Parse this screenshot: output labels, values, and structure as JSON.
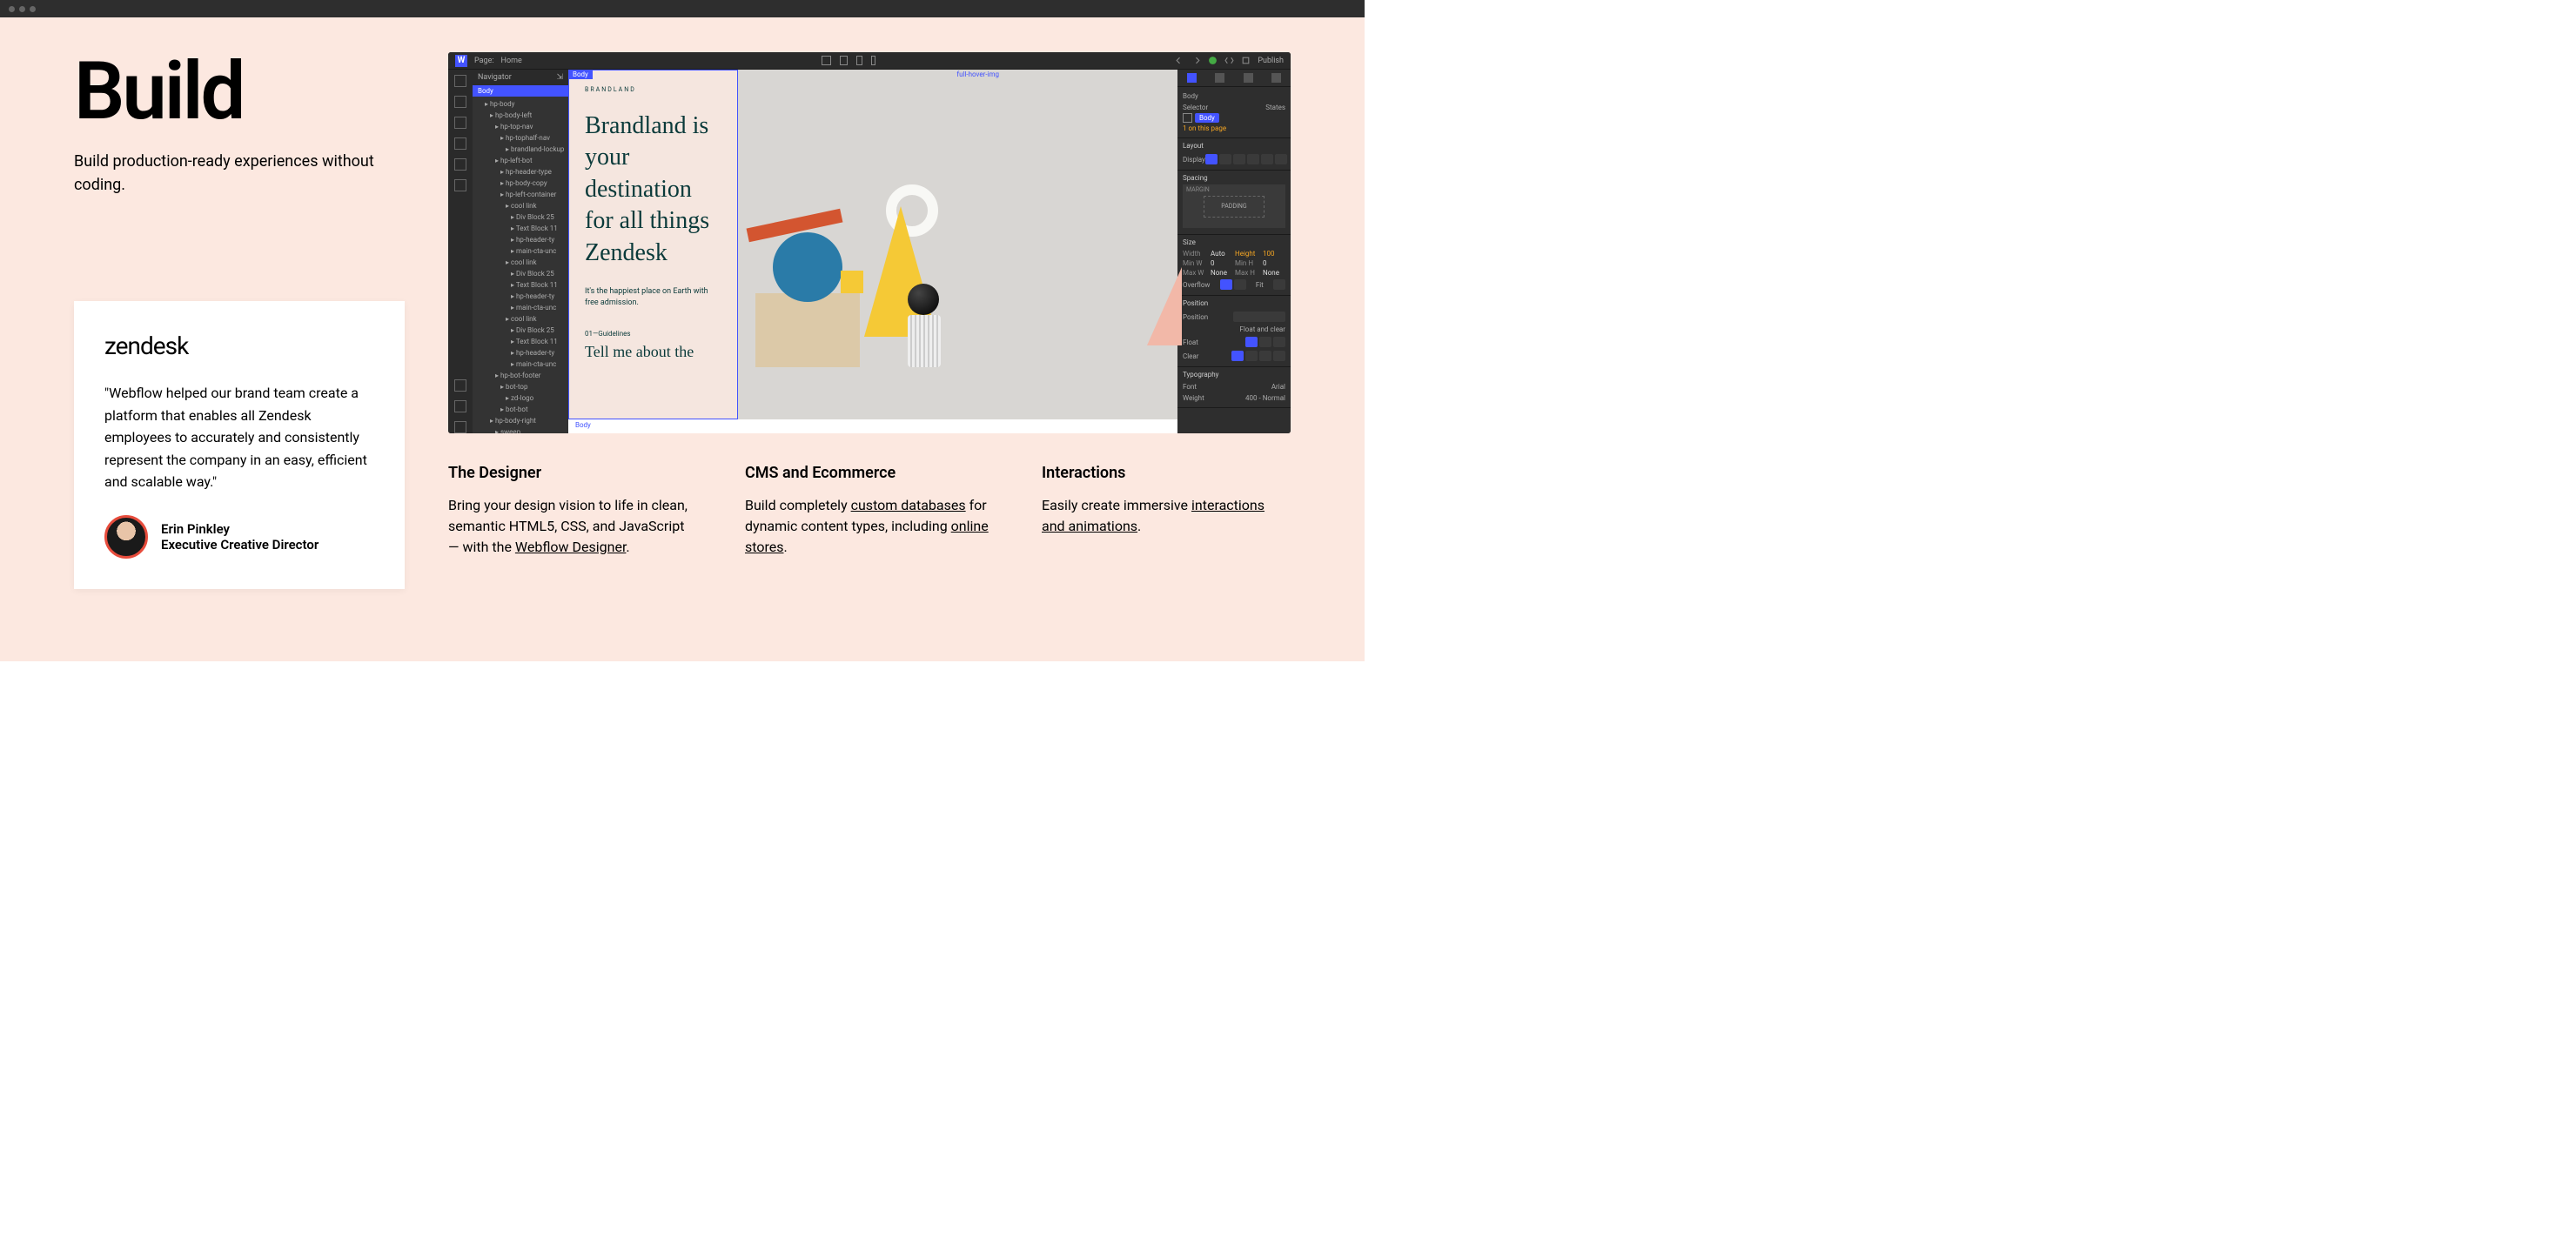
{
  "hero": {
    "title": "Build",
    "subtitle": "Build production-ready experiences without coding."
  },
  "testimonial": {
    "logo": "zendesk",
    "quote": "\"Webflow helped our brand team create a platform that enables all Zendesk employees to accurately and consistently represent the company in an easy, efficient and scalable way.\"",
    "author_name": "Erin Pinkley",
    "author_title": "Executive Creative Director"
  },
  "designer": {
    "topbar": {
      "page_label": "Page:",
      "page_name": "Home",
      "publish": "Publish"
    },
    "navigator": {
      "title": "Navigator",
      "root": "Body",
      "tree": [
        {
          "t": "hp-body",
          "d": 0
        },
        {
          "t": "hp-body-left",
          "d": 1
        },
        {
          "t": "hp-top-nav",
          "d": 2
        },
        {
          "t": "hp-tophalf-nav",
          "d": 3
        },
        {
          "t": "brandland-lockup",
          "d": 4
        },
        {
          "t": "hp-left-bot",
          "d": 2
        },
        {
          "t": "hp-header-type",
          "d": 3
        },
        {
          "t": "hp-body-copy",
          "d": 3
        },
        {
          "t": "hp-left-container",
          "d": 3
        },
        {
          "t": "cool link",
          "d": 4
        },
        {
          "t": "Div Block 25",
          "d": 5
        },
        {
          "t": "Text Block 11",
          "d": 5
        },
        {
          "t": "hp-header-ty",
          "d": 5
        },
        {
          "t": "main-cta-unc",
          "d": 5
        },
        {
          "t": "cool link",
          "d": 4
        },
        {
          "t": "Div Block 25",
          "d": 5
        },
        {
          "t": "Text Block 11",
          "d": 5
        },
        {
          "t": "hp-header-ty",
          "d": 5
        },
        {
          "t": "main-cta-unc",
          "d": 5
        },
        {
          "t": "cool link",
          "d": 4
        },
        {
          "t": "Div Block 25",
          "d": 5
        },
        {
          "t": "Text Block 11",
          "d": 5
        },
        {
          "t": "hp-header-ty",
          "d": 5
        },
        {
          "t": "main-cta-unc",
          "d": 5
        },
        {
          "t": "hp-bot-footer",
          "d": 2
        },
        {
          "t": "bot-top",
          "d": 3
        },
        {
          "t": "zd-logo",
          "d": 4
        },
        {
          "t": "bot-bot",
          "d": 3
        },
        {
          "t": "hp-body-right",
          "d": 1
        },
        {
          "t": "sweep",
          "d": 2
        }
      ]
    },
    "canvas": {
      "tag": "Body",
      "tag2": "full-hover-img",
      "label": "BRANDLAND",
      "hero": "Brandland is your destination for all things Zendesk",
      "sub": "It's the happiest place on Earth with free admission.",
      "guide": "01—Guidelines",
      "tell": "Tell me about the"
    },
    "styles": {
      "body_label": "Body",
      "selector_label": "Selector",
      "states_label": "States",
      "selector_tag": "Body",
      "on_page": "1 on this page",
      "layout": "Layout",
      "display": "Display",
      "spacing": "Spacing",
      "margin": "MARGIN",
      "padding": "PADDING",
      "size": "Size",
      "width": "Width",
      "width_v": "Auto",
      "height": "Height",
      "height_v": "100",
      "minw": "Min W",
      "minw_v": "0",
      "minh": "Min H",
      "minh_v": "0",
      "maxw": "Max W",
      "maxw_v": "None",
      "maxh": "Max H",
      "maxh_v": "None",
      "overflow": "Overflow",
      "fit": "Fit",
      "position": "Position",
      "position_v": "Position",
      "float_clear": "Float and clear",
      "float": "Float",
      "clear": "Clear",
      "typography": "Typography",
      "font": "Font",
      "font_v": "Arial",
      "weight": "Weight",
      "weight_v": "400 - Normal"
    },
    "footer_crumb": "Body"
  },
  "features": [
    {
      "title": "The Designer",
      "text_parts": [
        "Bring your design vision to life in clean, semantic HTML5, CSS, and JavaScript — with the ",
        "Webflow Designer",
        "."
      ]
    },
    {
      "title": "CMS and Ecommerce",
      "text_parts": [
        "Build completely ",
        "custom databases",
        " for dynamic content types, including ",
        "online stores",
        "."
      ]
    },
    {
      "title": "Interactions",
      "text_parts": [
        "Easily create immersive ",
        "interactions and animations",
        "."
      ]
    }
  ]
}
